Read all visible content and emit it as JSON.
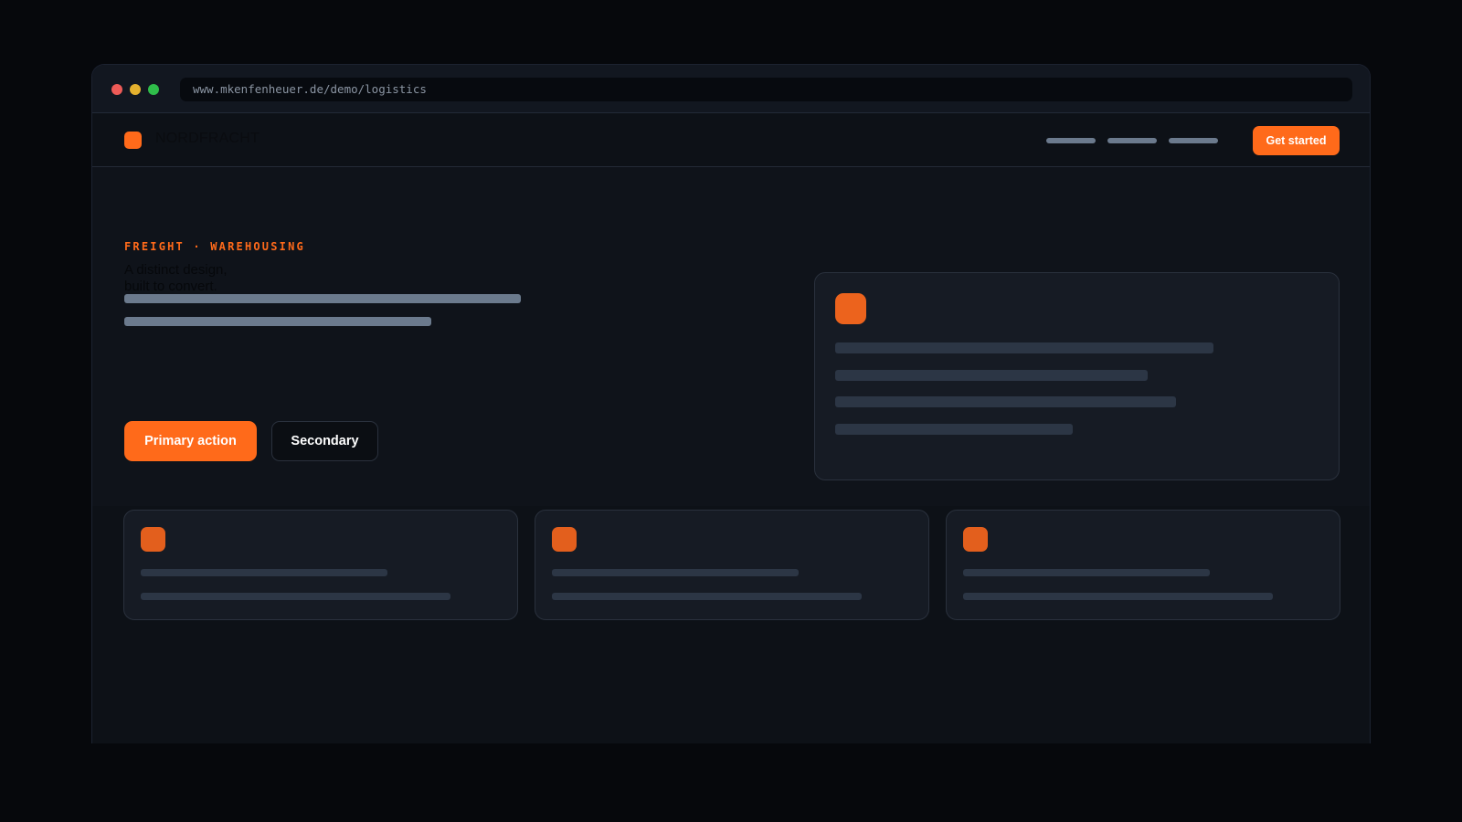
{
  "browser": {
    "url": "www.mkenfenheuer.de/demo/logistics"
  },
  "nav": {
    "brand": "NORDFRACHT",
    "cta_label": "Get started"
  },
  "hero": {
    "eyebrow": "FREIGHT · WAREHOUSING",
    "headline_line1": "A distinct design,",
    "headline_line2": "built to convert.",
    "primary_label": "Primary action",
    "secondary_label": "Secondary"
  },
  "colors": {
    "accent": "#ff6a1a",
    "background": "#0d1117",
    "card": "#161b24",
    "placeholder": "#6b7a8d"
  }
}
